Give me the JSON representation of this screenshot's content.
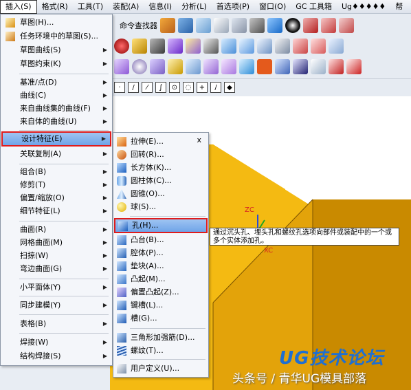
{
  "menubar": {
    "items": [
      "插入(S)",
      "格式(R)",
      "工具(T)",
      "装配(A)",
      "信息(I)",
      "分析(L)",
      "首选项(P)",
      "窗口(O)",
      "GC 工具箱",
      "Ug♦♦♦♦♦",
      "帮"
    ]
  },
  "toolbar": {
    "find_label": "命令查找器"
  },
  "insert_menu": {
    "items": [
      {
        "label": "草图(H)...",
        "arrow": false
      },
      {
        "label": "任务环境中的草图(S)...",
        "arrow": false
      },
      {
        "label": "草图曲线(S)",
        "arrow": true
      },
      {
        "label": "草图约束(K)",
        "arrow": true
      },
      {
        "label": "基准/点(D)",
        "arrow": true
      },
      {
        "label": "曲线(C)",
        "arrow": true
      },
      {
        "label": "来自曲线集的曲线(F)",
        "arrow": true
      },
      {
        "label": "来自体的曲线(U)",
        "arrow": true
      },
      {
        "label": "设计特征(E)",
        "arrow": true
      },
      {
        "label": "关联复制(A)",
        "arrow": true
      },
      {
        "label": "组合(B)",
        "arrow": true
      },
      {
        "label": "修剪(T)",
        "arrow": true
      },
      {
        "label": "偏置/缩放(O)",
        "arrow": true
      },
      {
        "label": "细节特征(L)",
        "arrow": true
      },
      {
        "label": "曲面(R)",
        "arrow": true
      },
      {
        "label": "网格曲面(M)",
        "arrow": true
      },
      {
        "label": "扫掠(W)",
        "arrow": true
      },
      {
        "label": "弯边曲面(G)",
        "arrow": true
      },
      {
        "label": "小平面体(Y)",
        "arrow": true
      },
      {
        "label": "同步建模(Y)",
        "arrow": true
      },
      {
        "label": "表格(B)",
        "arrow": true
      },
      {
        "label": "焊接(W)",
        "arrow": true
      },
      {
        "label": "结构焊接(S)",
        "arrow": true
      }
    ]
  },
  "design_feature_menu": {
    "close": "x",
    "items": [
      {
        "label": "拉伸(E)...",
        "icon": "extrude-icon"
      },
      {
        "label": "回转(R)...",
        "icon": "revolve-icon"
      },
      {
        "label": "长方体(K)...",
        "icon": "block-icon"
      },
      {
        "label": "圆柱体(C)...",
        "icon": "cylinder-icon"
      },
      {
        "label": "圆锥(O)...",
        "icon": "cone-icon"
      },
      {
        "label": "球(S)...",
        "icon": "sphere-icon"
      },
      {
        "label": "孔(H)...",
        "icon": "hole-icon"
      },
      {
        "label": "凸台(B)...",
        "icon": "boss-icon"
      },
      {
        "label": "腔体(P)...",
        "icon": "pocket-icon"
      },
      {
        "label": "垫块(A)...",
        "icon": "pad-icon"
      },
      {
        "label": "凸起(M)...",
        "icon": "emboss-icon"
      },
      {
        "label": "偏置凸起(Z)...",
        "icon": "offset-emboss-icon"
      },
      {
        "label": "键槽(L)...",
        "icon": "slot-icon"
      },
      {
        "label": "槽(G)...",
        "icon": "groove-icon"
      },
      {
        "label": "三角形加强筋(D)...",
        "icon": "dart-icon"
      },
      {
        "label": "螺纹(T)...",
        "icon": "thread-icon"
      },
      {
        "label": "用户定义(U)...",
        "icon": "user-defined-icon"
      }
    ]
  },
  "tooltip": {
    "text": "通过沉头孔、埋头孔和螺纹孔选项向部件或装配中的一个或多个实体添加孔。"
  },
  "viewport": {
    "axis_z_label": "ZC",
    "axis_x_label": "XC",
    "body_color": "#f4ba12",
    "body_dark_color": "#c98a00",
    "body_mid_color": "#e3a30a"
  },
  "watermark": {
    "logo": "UG技术论坛",
    "text": "头条号 / 青华UG模具部落"
  },
  "colors": {
    "highlight_border": "#e01b1b",
    "highlight_fill": "#8bb8ee"
  }
}
